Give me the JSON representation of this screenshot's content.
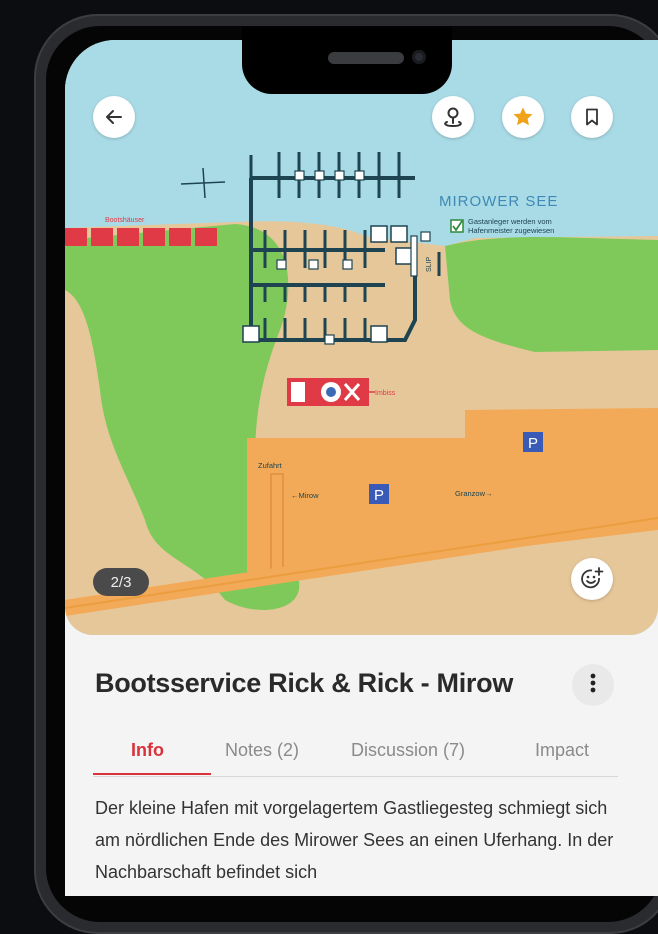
{
  "map": {
    "image_counter": "2/3",
    "lake_label": "MIROWER SEE",
    "legend_text_line1": "Gastanleger werden vom",
    "legend_text_line2": "Hafenmeister zugewiesen",
    "bootshaeuser_label": "Bootshäuser",
    "slip_label": "SLIP",
    "imbiss_label": "Imbiss",
    "zufahrt_label": "Zufahrt",
    "mirow_label": "←Mirow",
    "granzow_label": "Granzow→",
    "parking_label": "P"
  },
  "place": {
    "title": "Bootsservice Rick & Rick - Mirow"
  },
  "tabs": [
    {
      "label": "Info",
      "active": true
    },
    {
      "label": "Notes (2)",
      "active": false
    },
    {
      "label": "Discussion (7)",
      "active": false
    },
    {
      "label": "Impact",
      "active": false
    }
  ],
  "description": "Der kleine Hafen mit vorgelagertem Gastliegesteg schmiegt sich am nördlichen Ende des Mirower Sees an einen Uferhang. In der Nachbarschaft befindet sich",
  "icons": {
    "back": "back-arrow-icon",
    "location": "location-pin-icon",
    "favorite": "star-icon",
    "bookmark": "bookmark-icon",
    "more": "more-vertical-icon",
    "add_reaction": "add-reaction-icon"
  },
  "colors": {
    "accent": "#d9323a",
    "star": "#f0a21a",
    "water": "#a9dbe6",
    "land": "#e6c79a",
    "parking": "#f2aa58",
    "grass": "#7fc95a"
  }
}
